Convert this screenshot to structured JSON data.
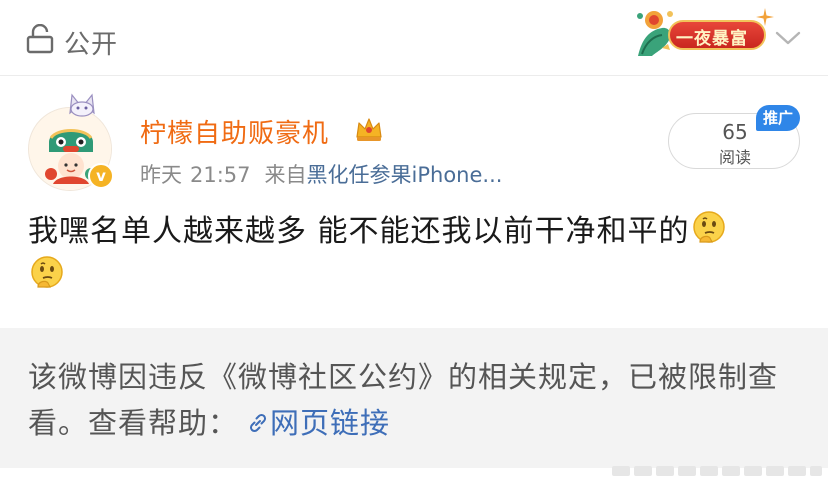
{
  "header": {
    "visibility_label": "公开",
    "banner_text": "一夜暴富"
  },
  "post": {
    "username": "柠檬自助贩豪机",
    "time_day": "昨天",
    "time_clock": "21:57",
    "from_prefix": "来自",
    "device": "黑化任参果iPhone...",
    "read_count": "65",
    "read_label": "阅读",
    "promo_tag": "推广",
    "body_text": "我嘿名单人越来越多 能不能还我以前干净和平的",
    "verified_mark": "v"
  },
  "notice": {
    "text": "该微博因违反《微博社区公约》的相关规定，已被限制查看。查看帮助：",
    "link_text": "网页链接"
  },
  "colors": {
    "username": "#f06b13",
    "link": "#3e6eb8",
    "promo": "#2f86e8",
    "notice_bg": "#f3f3f3"
  },
  "icons": {
    "lock": "lock-icon",
    "chevron": "chevron-down-icon",
    "crown": "crown-icon",
    "emoji": "thinking-face-emoji",
    "link": "link-icon"
  }
}
